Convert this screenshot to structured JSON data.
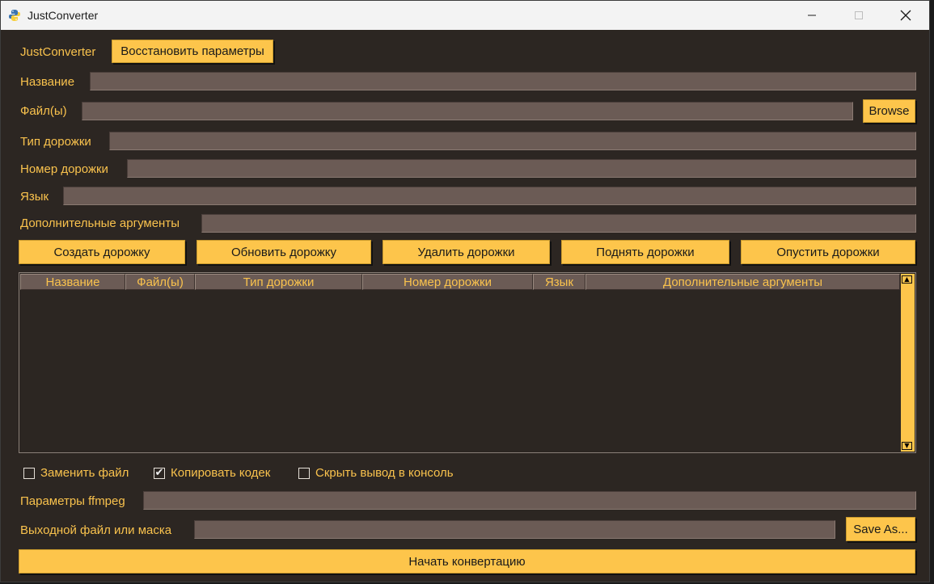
{
  "window": {
    "title": "JustConverter"
  },
  "top": {
    "app_label": "JustConverter",
    "restore_button": "Восстановить параметры"
  },
  "form": {
    "name_label": "Название",
    "files_label": "Файл(ы)",
    "browse_button": "Browse",
    "track_type_label": "Тип дорожки",
    "track_number_label": "Номер дорожки",
    "language_label": "Язык",
    "extra_args_label": "Дополнительные аргументы"
  },
  "actions": {
    "create": "Создать дорожку",
    "update": "Обновить дорожку",
    "delete": "Удалить дорожки",
    "raise": "Поднять дорожки",
    "lower": "Опустить дорожки"
  },
  "table": {
    "columns": [
      "Название",
      "Файл(ы)",
      "Тип дорожки",
      "Номер дорожки",
      "Язык",
      "Дополнительные аргументы"
    ],
    "rows": []
  },
  "options": {
    "replace_file": {
      "label": "Заменить файл",
      "checked": false
    },
    "copy_codec": {
      "label": "Копировать кодек",
      "checked": true,
      "mark": "✔"
    },
    "hide_output": {
      "label": "Скрыть вывод в консоль",
      "checked": false
    }
  },
  "bottom": {
    "ffmpeg_label": "Параметры ffmpeg",
    "output_label": "Выходной файл или маска",
    "save_as_button": "Save As...",
    "start_button": "Начать конвертацию"
  },
  "colors": {
    "background": "#2c2622",
    "accent": "#fdc54b",
    "field": "#6b5b55",
    "label": "#f9c24d"
  }
}
